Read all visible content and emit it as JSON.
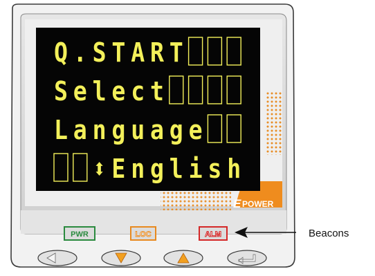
{
  "lcd": {
    "rows": [
      {
        "chars": [
          "Q",
          ".",
          "S",
          "T",
          "A",
          "R",
          "T",
          "",
          "",
          ""
        ]
      },
      {
        "chars": [
          "S",
          "e",
          "l",
          "e",
          "c",
          "t",
          "",
          "",
          "",
          ""
        ]
      },
      {
        "chars": [
          "L",
          "a",
          "n",
          "g",
          "u",
          "a",
          "g",
          "e",
          "",
          ""
        ]
      },
      {
        "chars": [
          "",
          "",
          "⬍",
          "E",
          "n",
          "g",
          "l",
          "i",
          "s",
          "h"
        ]
      }
    ],
    "text_color": "#f3f05a",
    "background_color": "#050505"
  },
  "brand": {
    "mark": "E",
    "name": "POWER",
    "color": "#e8891e"
  },
  "beacons": {
    "pwr": {
      "label": "PWR",
      "color": "#2a8a3e"
    },
    "loc": {
      "label": "LOC",
      "color": "#e8891e"
    },
    "alm": {
      "label": "ALM",
      "color": "#d42727"
    }
  },
  "callout": {
    "label": "Beacons"
  },
  "keys": [
    {
      "icon": "left-arrow-icon"
    },
    {
      "icon": "down-arrow-icon"
    },
    {
      "icon": "up-arrow-icon"
    },
    {
      "icon": "enter-icon"
    }
  ],
  "colors": {
    "bezel": "#d9d9d9",
    "panel": "#ececec",
    "key_arrow_orange": "#f2a020"
  }
}
